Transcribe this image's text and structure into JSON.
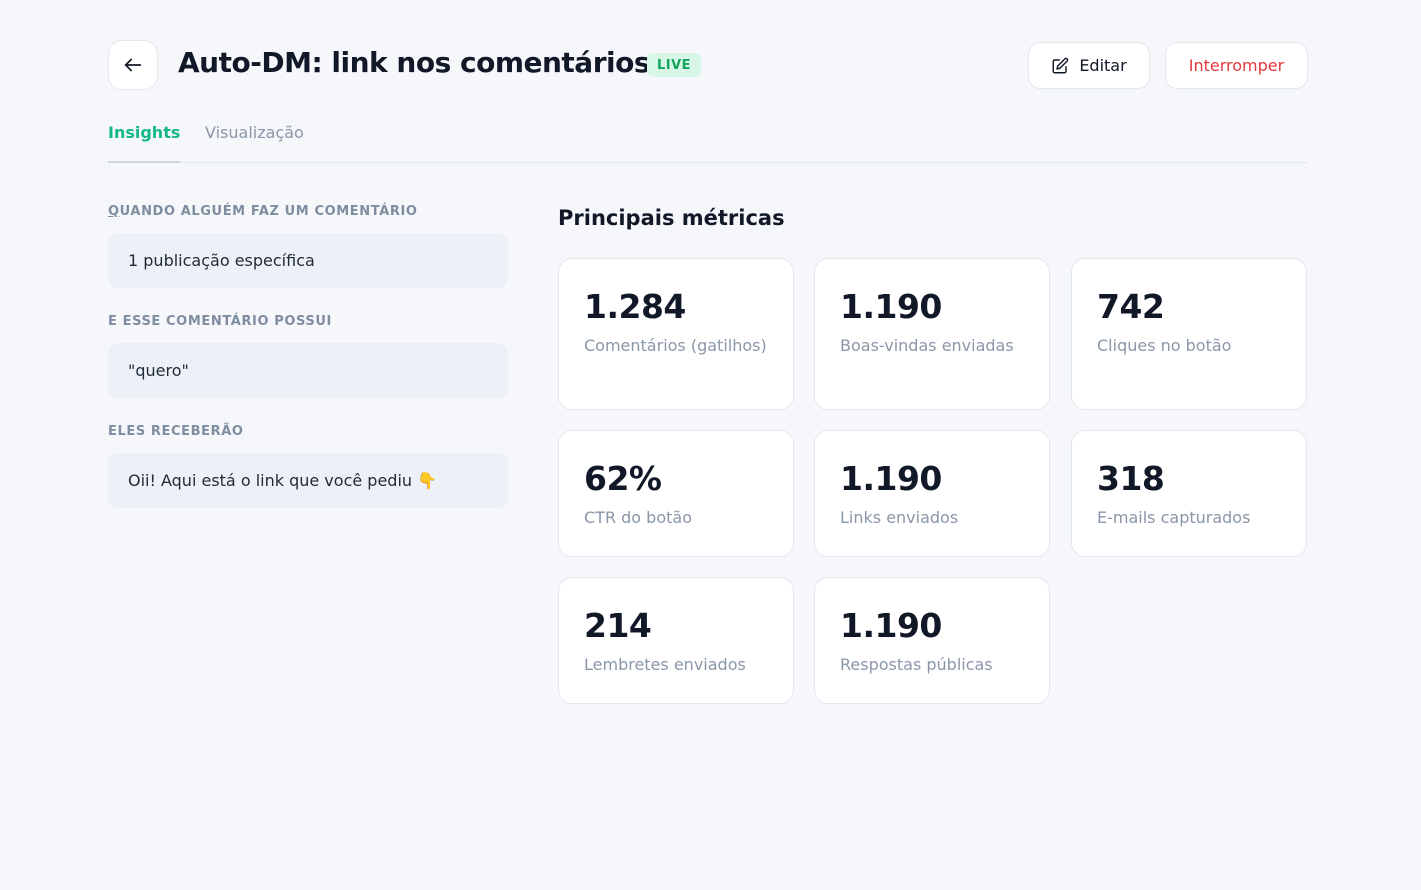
{
  "header": {
    "title": "Auto-DM: link nos comentários",
    "status_badge": "LIVE",
    "edit_label": "Editar",
    "stop_label": "Interromper"
  },
  "tabs": [
    {
      "label": "Insights",
      "active": true
    },
    {
      "label": "Visualização",
      "active": false
    }
  ],
  "trigger": {
    "when_label_first": "Q",
    "when_label_rest": "UANDO ALGUÉM FAZ UM COMENTÁRIO",
    "when_value": "1 publicação específica",
    "contains_label": "E ESSE COMENTÁRIO POSSUI",
    "contains_value": "\"quero\"",
    "receive_label": "ELES RECEBERÃO",
    "receive_value": "Oii! Aqui está o link que você pediu 👇"
  },
  "metrics": {
    "title": "Principais métricas",
    "items": [
      {
        "value": "1.284",
        "label": "Comentários (gatilhos)"
      },
      {
        "value": "1.190",
        "label": "Boas-vindas enviadas"
      },
      {
        "value": "742",
        "label": "Cliques no botão"
      },
      {
        "value": "62%",
        "label": "CTR do botão"
      },
      {
        "value": "1.190",
        "label": "Links enviados"
      },
      {
        "value": "318",
        "label": "E-mails capturados"
      },
      {
        "value": "214",
        "label": "Lembretes enviados"
      },
      {
        "value": "1.190",
        "label": "Respostas públicas"
      }
    ]
  },
  "colors": {
    "accent": "#14b885",
    "live_bg": "#d8f7e7",
    "live_text": "#14a35a",
    "danger": "#e5383b"
  }
}
